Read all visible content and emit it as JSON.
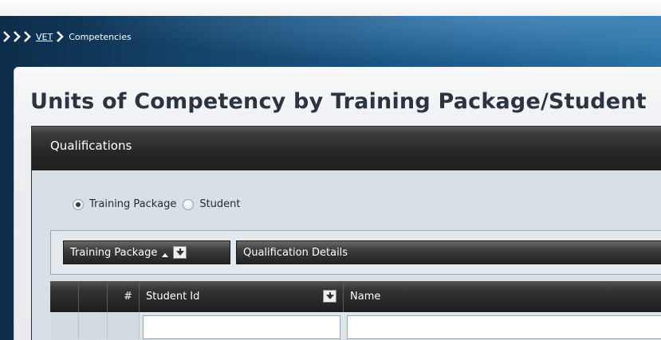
{
  "breadcrumb": {
    "items": [
      {
        "label": "VET",
        "link": true
      },
      {
        "label": "Competencies",
        "link": false
      }
    ]
  },
  "page": {
    "title": "Units of Competency by Training Package/Student"
  },
  "panel": {
    "title": "Qualifications"
  },
  "view_mode": {
    "options": [
      {
        "label": "Training Package",
        "selected": true
      },
      {
        "label": "Student",
        "selected": false
      }
    ]
  },
  "grouping": {
    "chips": [
      {
        "label": "Training Package",
        "sort": "ascending"
      },
      {
        "label": "Qualification Details"
      }
    ]
  },
  "grid": {
    "columns": [
      {
        "label": "#"
      },
      {
        "label": "Student Id"
      },
      {
        "label": "Name"
      }
    ],
    "filters": {
      "student_id": "",
      "name": ""
    }
  }
}
